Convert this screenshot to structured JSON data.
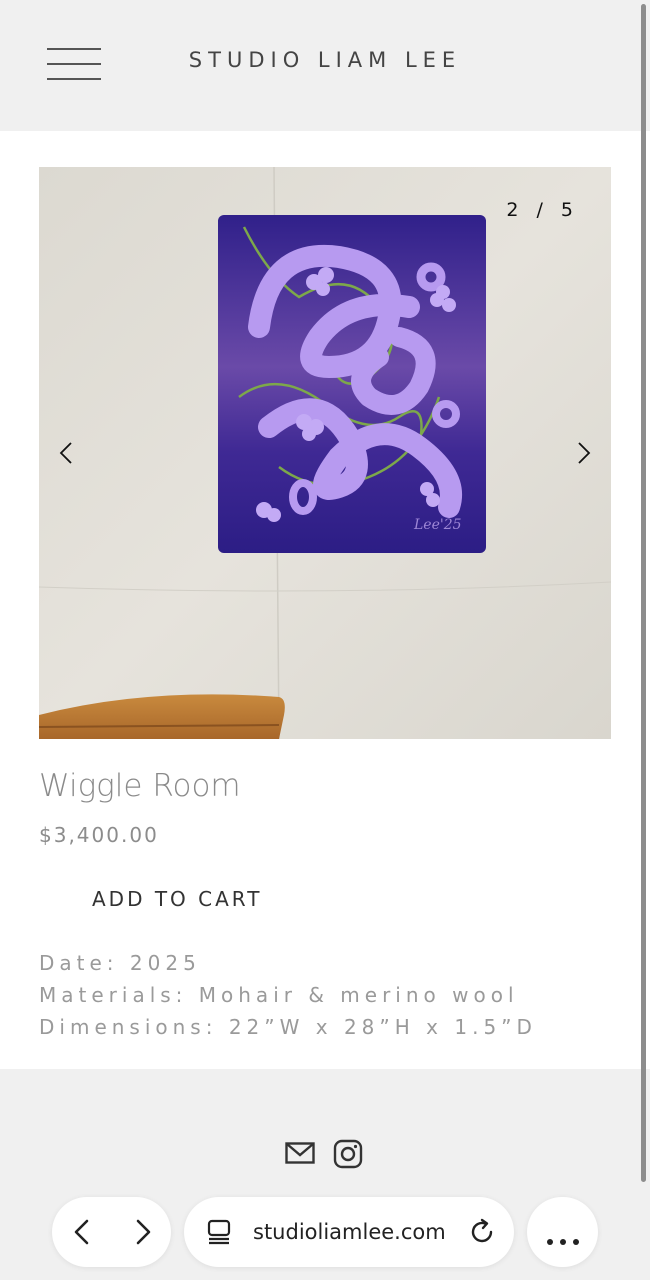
{
  "header": {
    "site_title": "STUDIO LIAM LEE"
  },
  "gallery": {
    "current": "2",
    "separator": "/",
    "total": "5",
    "signature": "Lee'25"
  },
  "product": {
    "title": "Wiggle Room",
    "price": "$3,400.00",
    "add_to_cart": "ADD TO CART",
    "specs": [
      "Date: 2025",
      "Materials: Mohair & merino wool",
      "Dimensions: 22”W x 28”H x 1.5”D"
    ]
  },
  "browser": {
    "url": "studioliamlee.com"
  },
  "icons": {
    "menu": "hamburger-menu-icon",
    "prev": "chevron-left-icon",
    "next": "chevron-right-icon",
    "mail": "mail-icon",
    "instagram": "instagram-icon",
    "back": "back-icon",
    "forward": "forward-icon",
    "tabs": "tab-switcher-icon",
    "reload": "reload-icon",
    "more": "more-icon"
  },
  "colors": {
    "background": "#f0f0f0",
    "content": "#ffffff",
    "artwork_base": "#3a2590",
    "artwork_tubes": "#b79af0"
  }
}
